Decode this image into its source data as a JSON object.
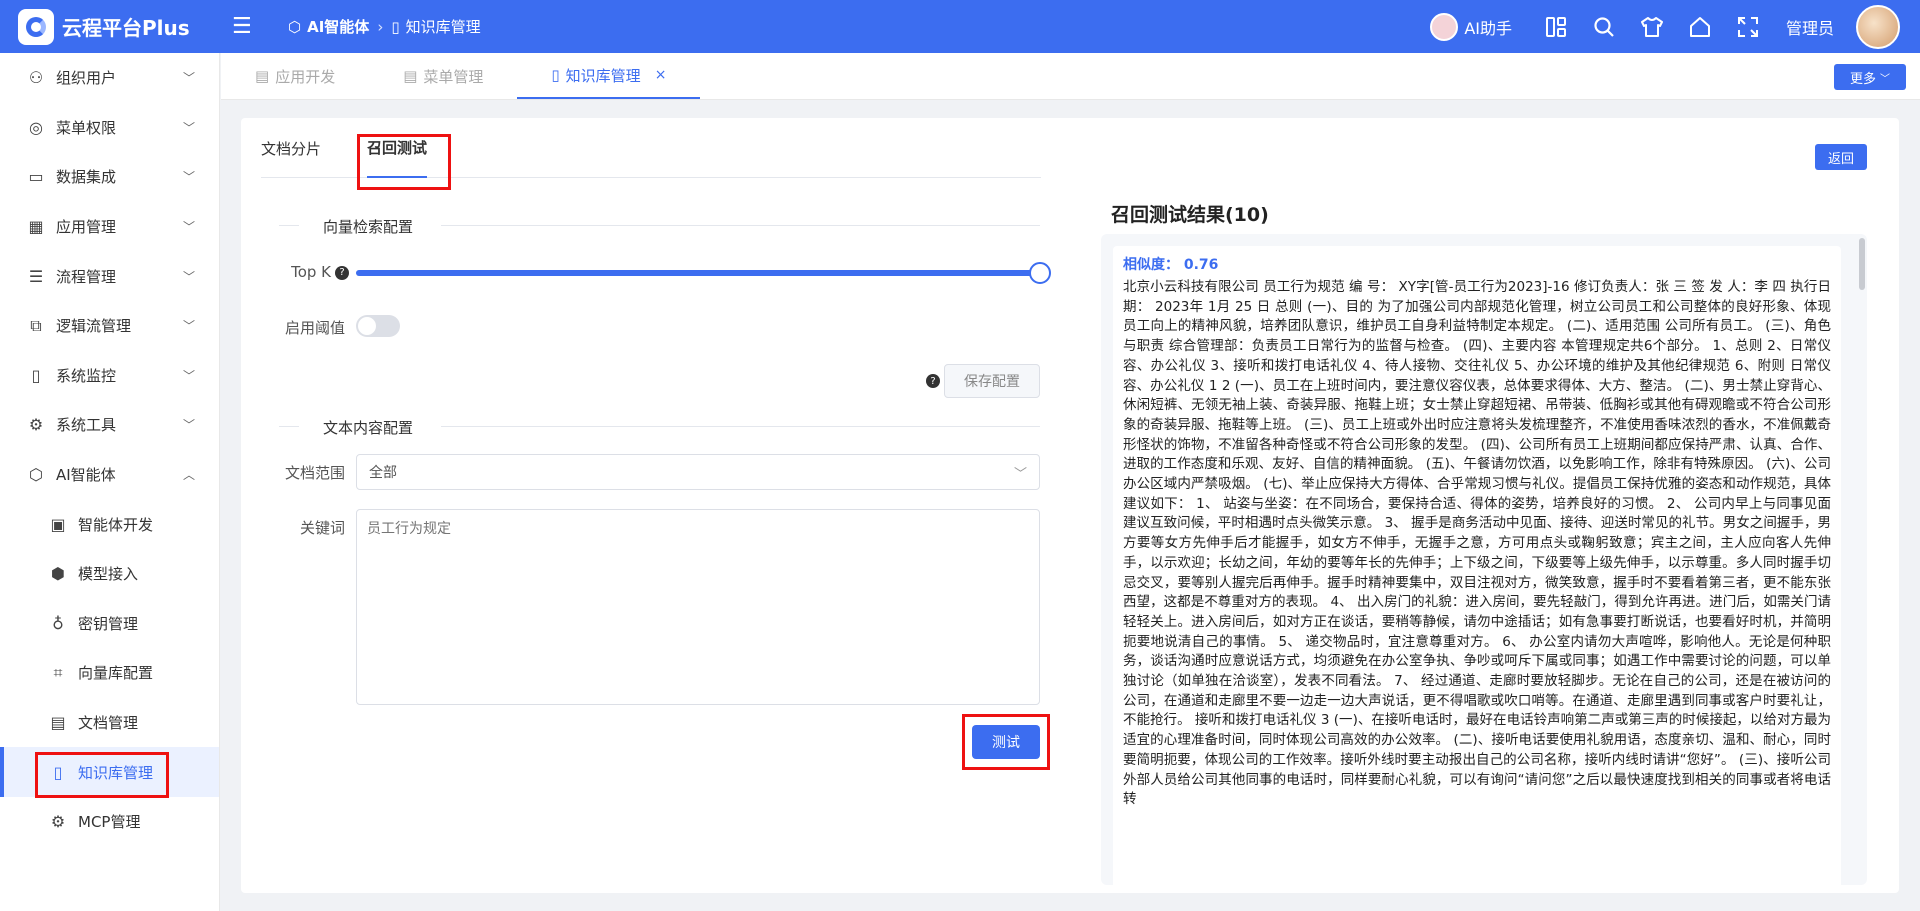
{
  "header": {
    "logo_text": "云程平台Plus",
    "breadcrumb": [
      {
        "label": "AI智能体",
        "icon": "cube-icon"
      },
      {
        "label": "知识库管理",
        "icon": "book-icon"
      }
    ],
    "ai_assistant": "AI助手",
    "user": "管理员",
    "brand_color": "#3c6df0"
  },
  "sidebar": {
    "items": [
      {
        "label": "组织用户",
        "icon": "user-org-icon"
      },
      {
        "label": "菜单权限",
        "icon": "target-icon"
      },
      {
        "label": "数据集成",
        "icon": "layers-icon"
      },
      {
        "label": "应用管理",
        "icon": "grid-icon"
      },
      {
        "label": "流程管理",
        "icon": "list-icon"
      },
      {
        "label": "逻辑流管理",
        "icon": "flow-icon"
      },
      {
        "label": "系统监控",
        "icon": "monitor-icon"
      },
      {
        "label": "系统工具",
        "icon": "gear-icon"
      },
      {
        "label": "AI智能体",
        "icon": "cube-icon"
      }
    ],
    "sub_items": [
      {
        "label": "智能体开发",
        "icon": "image-icon"
      },
      {
        "label": "模型接入",
        "icon": "box-icon"
      },
      {
        "label": "密钥管理",
        "icon": "key-icon"
      },
      {
        "label": "向量库配置",
        "icon": "crop-icon"
      },
      {
        "label": "文档管理",
        "icon": "document-icon"
      },
      {
        "label": "知识库管理",
        "icon": "book-icon"
      },
      {
        "label": "MCP管理",
        "icon": "gear-icon"
      }
    ]
  },
  "tabs": [
    {
      "label": "应用开发"
    },
    {
      "label": "菜单管理"
    },
    {
      "label": "知识库管理",
      "close": "×"
    }
  ],
  "more_btn": "更多",
  "inner_tabs": [
    "文档分片",
    "召回测试"
  ],
  "return_btn": "返回",
  "vector_section": {
    "title": "向量检索配置",
    "topk_label": "Top K",
    "topk_value_fraction": 1.0,
    "threshold_label": "启用阈值",
    "save_btn": "保存配置"
  },
  "text_section": {
    "title": "文本内容配置",
    "scope_label": "文档范围",
    "scope_value": "全部",
    "keyword_label": "关键词",
    "keyword_placeholder": "员工行为规定",
    "test_btn": "测试"
  },
  "results": {
    "title": "召回测试结果(10)",
    "similarity": "相似度：  0.76",
    "text": "北京小云科技有限公司 员工行为规范 编 号： XY字[管-员工行为2023]-16 修订负责人：张 三 签 发 人：李 四 执行日期： 2023年 1月 25 日 总则 (一)、目的 为了加强公司内部规范化管理，树立公司员工和公司整体的良好形象、体现员工向上的精神风貌，培养团队意识，维护员工自身利益特制定本规定。 (二)、适用范围 公司所有员工。 (三)、角色与职责 综合管理部：负责员工日常行为的监督与检查。 (四)、主要内容 本管理规定共6个部分。 1、总则 2、日常仪容、办公礼仪 3、接听和拨打电话礼仪 4、待人接物、交往礼仪 5、办公环境的维护及其他纪律规范 6、附则 日常仪容、办公礼仪 1 2 (一)、员工在上班时间内，要注意仪容仪表，总体要求得体、大方、整洁。 (二)、男士禁止穿背心、休闲短裤、无领无袖上装、奇装异服、拖鞋上班；女士禁止穿超短裙、吊带装、低胸衫或其他有碍观瞻或不符合公司形象的奇装异服、拖鞋等上班。 (三)、员工上班或外出时应注意将头发梳理整齐，不准使用香味浓烈的香水，不准佩戴奇形怪状的饰物，不准留各种奇怪或不符合公司形象的发型。 (四)、公司所有员工上班期间都应保持严肃、认真、合作、进取的工作态度和乐观、友好、自信的精神面貌。 (五)、午餐请勿饮酒，以免影响工作，除非有特殊原因。 (六)、公司办公区域内严禁吸烟。 (七)、举止应保持大方得体、合乎常规习惯与礼仪。提倡员工保持优雅的姿态和动作规范，具体建议如下： 1、 站姿与坐姿：在不同场合，要保持合适、得体的姿势，培养良好的习惯。 2、 公司内早上与同事见面建议互致问候，平时相遇时点头微笑示意。 3、 握手是商务活动中见面、接待、迎送时常见的礼节。男女之间握手，男方要等女方先伸手后才能握手，如女方不伸手，无握手之意，方可用点头或鞠躬致意；宾主之间，主人应向客人先伸手，以示欢迎；长幼之间，年幼的要等年长的先伸手；上下级之间，下级要等上级先伸手，以示尊重。多人同时握手切忌交叉，要等别人握完后再伸手。握手时精神要集中，双目注视对方，微笑致意，握手时不要看着第三者，更不能东张西望，这都是不尊重对方的表现。 4、 出入房门的礼貌：进入房间，要先轻敲门，得到允许再进。进门后，如需关门请轻轻关上。进入房间后，如对方正在谈话，要稍等静候，请勿中途插话；如有急事要打断说话，也要看好时机，并简明扼要地说清自己的事情。 5、 递交物品时，宜注意尊重对方。 6、 办公室内请勿大声喧哗，影响他人。无论是何种职务，谈话沟通时应意说话方式，均须避免在办公室争执、争吵或呵斥下属或同事；如遇工作中需要讨论的问题，可以单独讨论（如单独在洽谈室），发表不同看法。 7、 经过通道、走廊时要放轻脚步。无论在自己的公司，还是在被访问的公司，在通道和走廊里不要一边走一边大声说话，更不得唱歌或吹口哨等。在通道、走廊里遇到同事或客户时要礼让，不能抢行。 接听和拨打电话礼仪 3 (一)、在接听电话时，最好在电话铃声响第二声或第三声的时候接起，以给对方最为适宜的心理准备时间，同时体现公司高效的办公效率。 (二)、接听电话要使用礼貌用语，态度亲切、温和、耐心，同时要简明扼要，体现公司的工作效率。接听外线时要主动报出自己的公司名称，接听内线时请讲“您好”。 (三)、接听公司外部人员给公司其他同事的电话时，同样要耐心礼貌，可以有询问“请问您”之后以最快速度找到相关的同事或者将电话转"
  }
}
